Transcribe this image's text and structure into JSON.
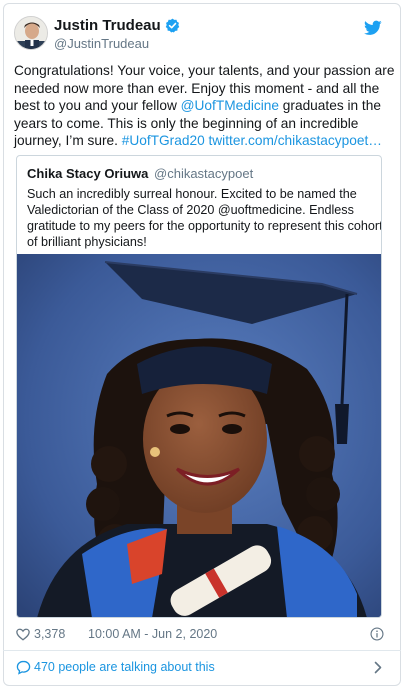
{
  "tweet": {
    "author_name": "Justin Trudeau",
    "author_handle": "@JustinTrudeau",
    "text_lines": [
      "Congratulations! Your voice, your talents, and your passion are",
      "needed now more than ever. Enjoy this moment - and all the",
      {
        "pre": "best to you and your fellow ",
        "link": "@UofTMedicine",
        "post": " graduates in the"
      },
      "years to come. This is only the beginning of an incredible",
      {
        "pre": "journey, I’m sure. ",
        "link": "#UofTGrad20 twitter.com/chikastacypoet…",
        "post": ""
      }
    ],
    "likes": "3,378",
    "timestamp": "10:00 AM - Jun 2, 2020",
    "talking": "470 people are talking about this"
  },
  "quoted": {
    "name": "Chika Stacy Oriuwa",
    "handle": "@chikastacypoet",
    "text_lines": [
      "Such an incredibly surreal honour. Excited to be named the",
      "Valedictorian of the Class of 2020 @uoftmedicine. Endless",
      "gratitude to my peers for the opportunity to represent this cohort",
      "of brilliant physicians!"
    ]
  },
  "icons": {
    "verified": "verified-badge-icon",
    "bird": "twitter-bird-icon",
    "heart": "heart-icon",
    "info": "info-icon",
    "bubble": "speech-bubble-icon",
    "chevron": "chevron-right-icon"
  },
  "colors": {
    "link": "#1b95e0",
    "muted": "#657786",
    "text": "#14171a"
  }
}
